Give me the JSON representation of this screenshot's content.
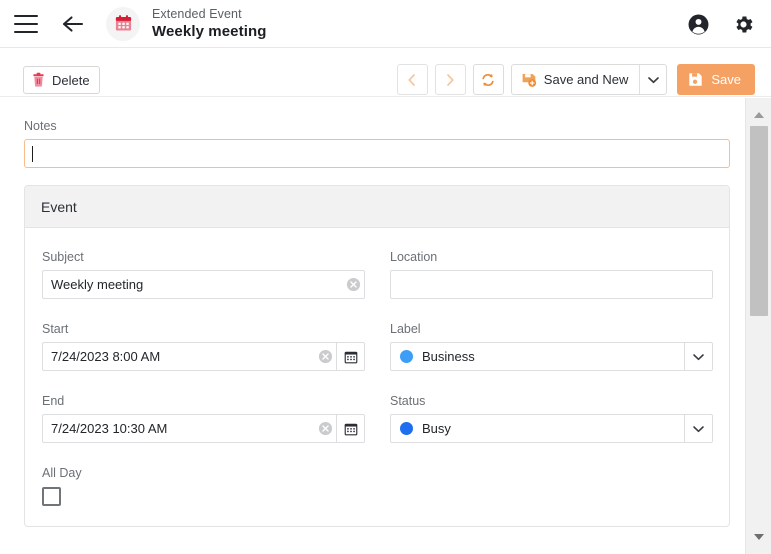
{
  "header": {
    "menu_icon": "hamburger-icon",
    "back_icon": "back-arrow-icon",
    "avatar_icon": "calendar-icon",
    "subtitle": "Extended Event",
    "title": "Weekly meeting",
    "account_icon": "account-circle-icon",
    "settings_icon": "gear-icon"
  },
  "toolbar": {
    "delete_label": "Delete",
    "delete_icon": "trash-icon",
    "prev_icon": "chevron-left-icon",
    "next_icon": "chevron-right-icon",
    "refresh_icon": "refresh-icon",
    "save_and_new_label": "Save and New",
    "save_and_new_icon": "save-add-icon",
    "split_arrow_icon": "chevron-down-icon",
    "save_label": "Save",
    "save_icon": "save-disk-icon"
  },
  "notes": {
    "label": "Notes",
    "value": ""
  },
  "panel": {
    "title": "Event",
    "fields": {
      "subject": {
        "label": "Subject",
        "value": "Weekly meeting",
        "clear_icon": "clear-circle-icon"
      },
      "location": {
        "label": "Location",
        "value": ""
      },
      "start": {
        "label": "Start",
        "value": "7/24/2023 8:00 AM",
        "clear_icon": "clear-circle-icon",
        "calendar_icon": "calendar-picker-icon"
      },
      "end": {
        "label": "End",
        "value": "7/24/2023 10:30 AM",
        "clear_icon": "clear-circle-icon",
        "calendar_icon": "calendar-picker-icon"
      },
      "label_select": {
        "label": "Label",
        "value": "Business",
        "dot_color": "#3d9ef5",
        "arrow_icon": "chevron-down-icon"
      },
      "status_select": {
        "label": "Status",
        "value": "Busy",
        "dot_color": "#1f6ef0",
        "arrow_icon": "chevron-down-icon"
      },
      "all_day": {
        "label": "All Day",
        "checked": false
      }
    }
  },
  "scrollbar": {
    "up_icon": "scroll-up-arrow-icon",
    "down_icon": "scroll-down-arrow-icon"
  },
  "colors": {
    "accent_orange": "#f5a163",
    "delete_red": "#e8384f",
    "calendar_red": "#d31f36"
  }
}
